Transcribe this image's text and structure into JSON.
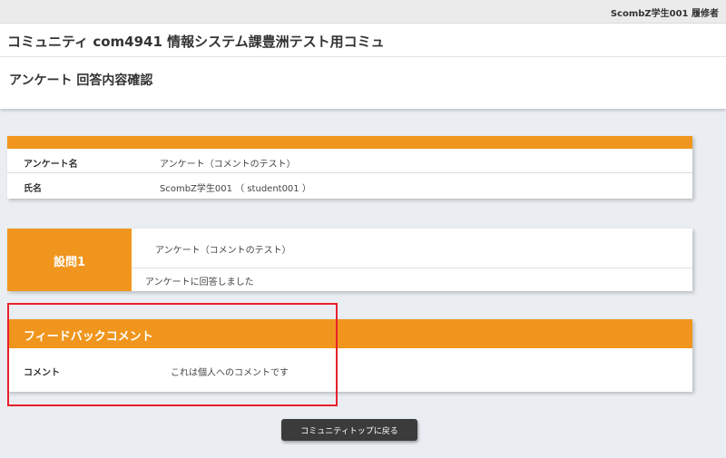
{
  "topbar": {
    "user_name": "ScombZ学生001 履修者"
  },
  "header": {
    "community_title": "コミュニティ com4941 情報システム課豊洲テスト用コミュ",
    "page_title": "アンケート 回答内容確認"
  },
  "survey_info": {
    "name_label": "アンケート名",
    "name_value": "アンケート（コメントのテスト）",
    "person_label": "氏名",
    "person_value": "ScombZ学生001 （ student001 ）"
  },
  "question": {
    "label": "設問1",
    "text": "アンケート（コメントのテスト）",
    "answer": "アンケートに回答しました"
  },
  "feedback": {
    "title": "フィードバックコメント",
    "comment_label": "コメント",
    "comment_value": "これは個人へのコメントです"
  },
  "actions": {
    "back_label": "コミュニティトップに戻る"
  },
  "colors": {
    "accent": "#f0961e",
    "highlight": "#e8202a",
    "button": "#3b3b3b"
  }
}
